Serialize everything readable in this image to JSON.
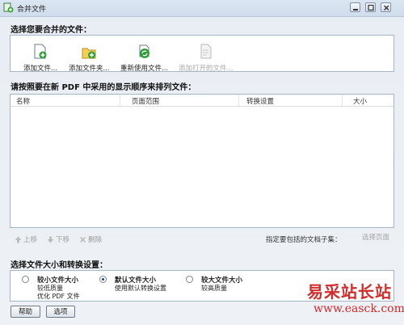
{
  "window": {
    "title": "合并文件"
  },
  "toolbar": {
    "heading": "选择您要合并的文件：",
    "add_files": "添加文件...",
    "add_folder": "添加文件夹...",
    "reuse_files": "重新使用文件...",
    "add_open_files": "添加打开的文件..."
  },
  "list": {
    "heading": "请按照要在新 PDF 中采用的显示顺序来排列文件：",
    "columns": [
      "名称",
      "页面范围",
      "转换设置",
      "大小"
    ],
    "move_up": "上移",
    "move_down": "下移",
    "remove": "删除",
    "subset_label": "指定要包括的文档子集：",
    "pick_pages": "选择页面"
  },
  "size_settings": {
    "heading": "选择文件大小和转换设置：",
    "options": [
      {
        "title": "较小文件大小",
        "lines": [
          "较低质量",
          "优化 PDF 文件"
        ],
        "selected": false
      },
      {
        "title": "默认文件大小",
        "lines": [
          "使用默认转换设置"
        ],
        "selected": true
      },
      {
        "title": "较大文件大小",
        "lines": [
          "较高质量"
        ],
        "selected": false
      }
    ]
  },
  "footer": {
    "help": "帮助",
    "options": "选项"
  },
  "watermark": {
    "title": "易采站长站",
    "url": "www.easck.com"
  },
  "colors": {
    "watermark_red": "#d12b2b",
    "panel_border": "#a7b4c4"
  }
}
